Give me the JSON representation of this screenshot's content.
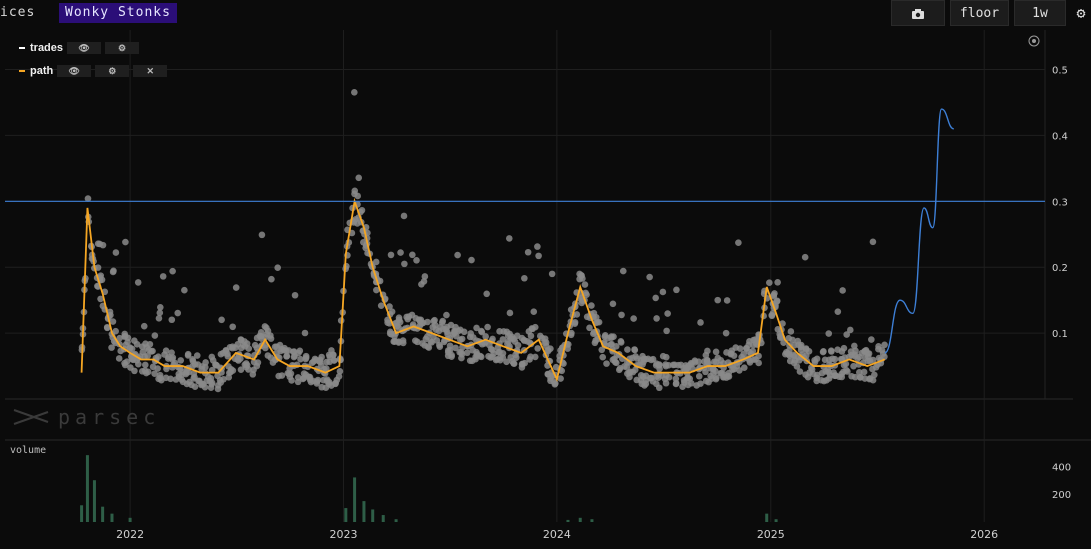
{
  "header": {
    "tab_label": "ices",
    "title": "Wonky Stonks",
    "buttons": {
      "camera_icon": "camera-icon",
      "floor": "floor",
      "interval": "1w",
      "settings_icon": "gear-icon"
    }
  },
  "legend": [
    {
      "name": "trades",
      "color": "#ffffff"
    },
    {
      "name": "path",
      "color": "#f5a623"
    }
  ],
  "watermark": "parsec",
  "volume_label": "volume",
  "colors": {
    "background": "#0b0b0b",
    "points": "#8a8a8a",
    "path": "#f5a623",
    "hline": "#3d7fd6",
    "forecast": "#3d7fd6",
    "volume": "#2e5e47"
  },
  "chart_data": {
    "type": "scatter",
    "x_ticks": [
      "2022",
      "2023",
      "2024",
      "2025",
      "2026"
    ],
    "x_range": [
      "2021-06-01",
      "2026-04-15"
    ],
    "y_ticks": [
      0.1,
      0.2,
      0.3,
      0.4,
      0.5
    ],
    "ylim": [
      0,
      0.56
    ],
    "grid": true,
    "horizontal_line": 0.3,
    "path_series": {
      "name": "path",
      "x": [
        "2021-10-10",
        "2021-10-20",
        "2021-11-01",
        "2021-11-15",
        "2021-12-01",
        "2021-12-15",
        "2022-01-01",
        "2022-01-20",
        "2022-02-10",
        "2022-03-01",
        "2022-04-01",
        "2022-05-01",
        "2022-06-01",
        "2022-07-01",
        "2022-08-01",
        "2022-08-20",
        "2022-09-10",
        "2022-10-01",
        "2022-11-01",
        "2022-12-01",
        "2022-12-25",
        "2023-01-05",
        "2023-01-20",
        "2023-02-05",
        "2023-02-20",
        "2023-03-10",
        "2023-04-01",
        "2023-05-01",
        "2023-06-01",
        "2023-07-01",
        "2023-08-01",
        "2023-09-01",
        "2023-10-01",
        "2023-11-01",
        "2023-12-01",
        "2024-01-01",
        "2024-01-20",
        "2024-02-10",
        "2024-03-01",
        "2024-03-20",
        "2024-04-15",
        "2024-05-15",
        "2024-06-15",
        "2024-07-15",
        "2024-08-15",
        "2024-09-15",
        "2024-10-15",
        "2024-11-15",
        "2024-12-10",
        "2024-12-25",
        "2025-01-10",
        "2025-01-25",
        "2025-02-15",
        "2025-03-15",
        "2025-04-15",
        "2025-05-15",
        "2025-06-15",
        "2025-07-15"
      ],
      "y": [
        0.04,
        0.29,
        0.2,
        0.16,
        0.1,
        0.08,
        0.07,
        0.06,
        0.06,
        0.05,
        0.05,
        0.04,
        0.04,
        0.07,
        0.06,
        0.09,
        0.06,
        0.05,
        0.05,
        0.04,
        0.05,
        0.22,
        0.3,
        0.26,
        0.2,
        0.15,
        0.1,
        0.11,
        0.1,
        0.09,
        0.08,
        0.09,
        0.08,
        0.07,
        0.09,
        0.03,
        0.1,
        0.17,
        0.12,
        0.08,
        0.07,
        0.05,
        0.04,
        0.04,
        0.04,
        0.05,
        0.05,
        0.06,
        0.07,
        0.17,
        0.13,
        0.09,
        0.07,
        0.05,
        0.05,
        0.06,
        0.05,
        0.06
      ]
    },
    "forecast_series": {
      "name": "",
      "x": [
        "2025-07-15",
        "2025-08-10",
        "2025-09-01",
        "2025-09-20",
        "2025-10-05",
        "2025-10-20",
        "2025-11-10"
      ],
      "y": [
        0.07,
        0.15,
        0.13,
        0.29,
        0.26,
        0.44,
        0.41
      ]
    },
    "volume_ticks": [
      200,
      400
    ],
    "volume_bars": {
      "x": [
        "2021-10-10",
        "2021-10-20",
        "2021-11-01",
        "2021-11-15",
        "2021-12-01",
        "2022-01-01",
        "2023-01-05",
        "2023-01-20",
        "2023-02-05",
        "2023-02-20",
        "2023-03-10",
        "2023-04-01",
        "2024-01-20",
        "2024-02-10",
        "2024-03-01",
        "2024-12-25",
        "2025-01-10"
      ],
      "y": [
        120,
        480,
        300,
        110,
        60,
        30,
        100,
        320,
        150,
        90,
        50,
        20,
        15,
        30,
        20,
        60,
        20
      ]
    }
  }
}
